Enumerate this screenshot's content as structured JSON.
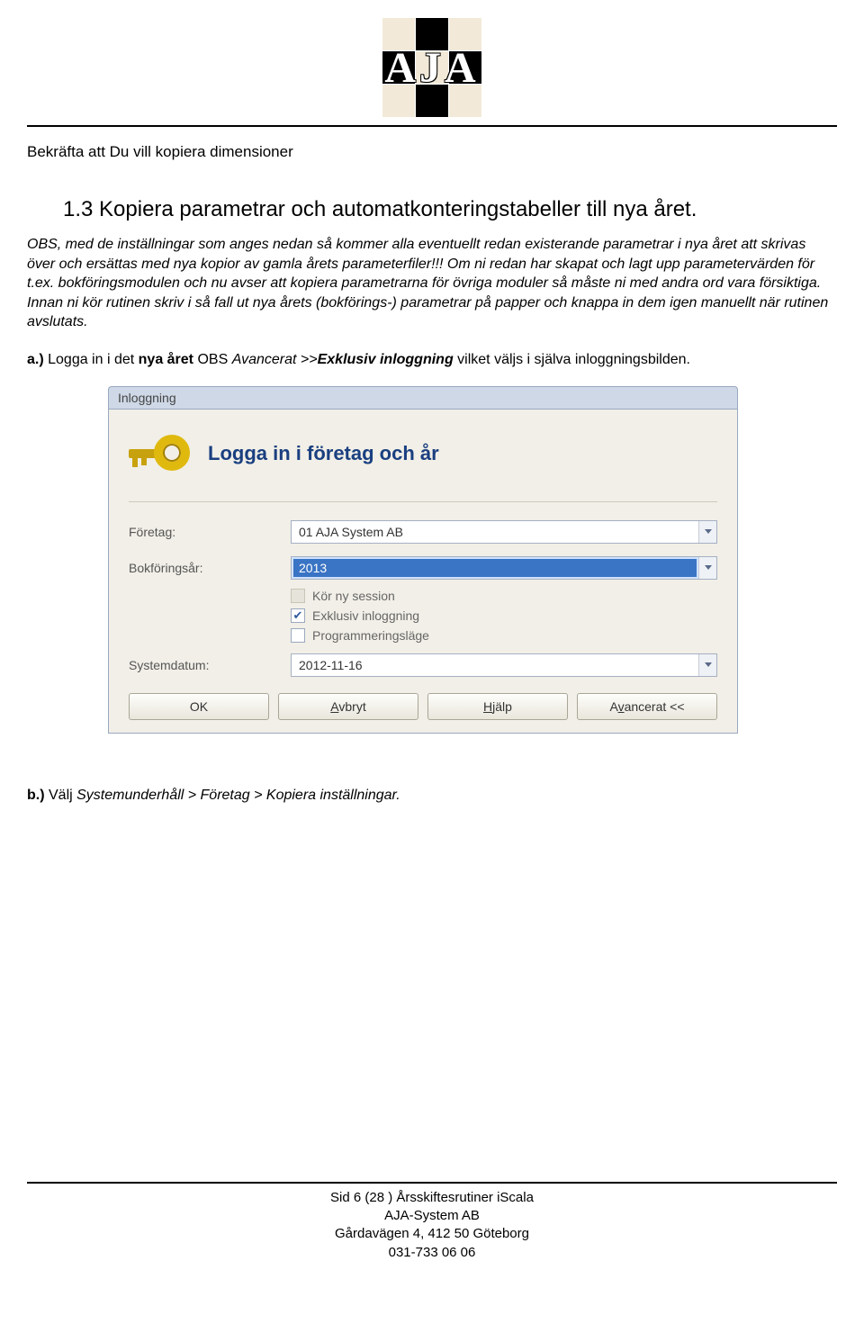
{
  "logo": {
    "text": "AJA"
  },
  "intro": "Bekräfta att Du vill kopiera dimensioner",
  "section_title": "1.3  Kopiera parametrar och automatkonteringstabeller till nya året.",
  "warning_paragraph": "OBS, med de inställningar som anges nedan så kommer alla eventuellt redan existerande parametrar i nya året att skrivas över och ersättas med nya kopior av gamla årets parameterfiler!!! Om ni redan har skapat och lagt upp parametervärden för t.ex. bokföringsmodulen och nu avser att kopiera parametrarna för övriga moduler så måste ni med andra ord vara försiktiga. Innan ni kör rutinen skriv i så fall ut nya årets (bokförings-) parametrar på papper och knappa in dem igen manuellt när rutinen avslutats.",
  "step_a": {
    "marker": "a.)",
    "t1": " Logga in i det ",
    "bold1": "nya året",
    "t2": " OBS ",
    "ital1": "Avancerat  >>",
    "bolditalic": "Exklusiv inloggning",
    "t3": " vilket väljs i själva inloggningsbilden."
  },
  "step_b": {
    "marker": "b.)",
    "t1": " Välj ",
    "ital": "Systemunderhåll > Företag > Kopiera inställningar."
  },
  "dialog": {
    "title": "Inloggning",
    "header": "Logga in i företag och år",
    "labels": {
      "company": "Företag:",
      "year": "Bokföringsår:",
      "sysdate": "Systemdatum:"
    },
    "values": {
      "company": "01   AJA System AB",
      "year": "2013",
      "sysdate": "2012-11-16"
    },
    "checks": {
      "kor_ny": "Kör ny session",
      "exklusiv": "Exklusiv inloggning",
      "prog": "Programmeringsläge"
    },
    "buttons": {
      "ok": "OK",
      "avbryt_pre": "A",
      "avbryt_rest": "vbryt",
      "hjalp_pre": "H",
      "hjalp_rest": "jälp",
      "avancerat_pre": "A",
      "avancerat_mid": "v",
      "avancerat_rest": "ancerat <<"
    }
  },
  "footer": {
    "l1": "Sid 6 (28 ) Årsskiftesrutiner iScala",
    "l2": "AJA-System AB",
    "l3": "Gårdavägen 4, 412 50 Göteborg",
    "l4": "031-733 06 06"
  }
}
